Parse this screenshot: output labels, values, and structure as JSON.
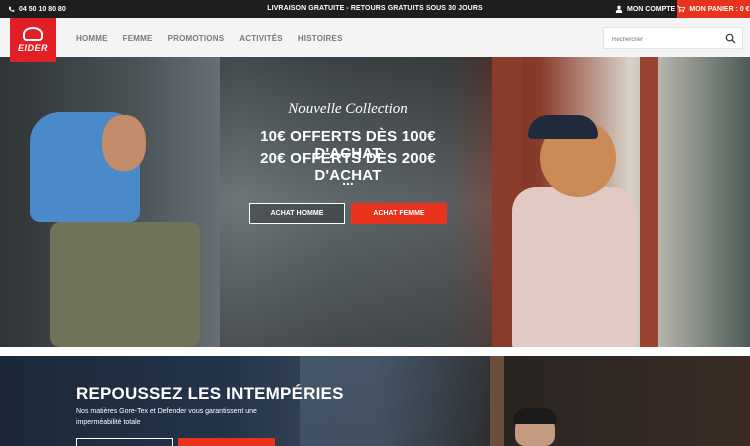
{
  "topbar": {
    "phone": "04 50 10 80 80",
    "promo": "LIVRAISON GRATUITE  -  RETOURS GRATUITS SOUS 30 JOURS",
    "account": "MON COMPTE",
    "cart": "MON PANIER : 0 €"
  },
  "brand": {
    "logo_text": "EIDER"
  },
  "nav": {
    "items": [
      "HOMME",
      "FEMME",
      "PROMOTIONS",
      "ACTIVITÉS",
      "HISTOIRES"
    ]
  },
  "search": {
    "placeholder": "Rechercher"
  },
  "hero": {
    "kicker": "Nouvelle Collection",
    "line1": "10€ OFFERTS DÈS 100€ D'ACHAT",
    "line2": "20€ OFFERTS DÈS 200€ D'ACHAT",
    "dots": "...",
    "btn_men": "ACHAT HOMME",
    "btn_women": "ACHAT FEMME"
  },
  "banner2": {
    "title": "REPOUSSEZ LES INTEMPÉRIES",
    "text": "Nos matières Gore-Tex et Defender vous garantissent une imperméabilité totale"
  },
  "colors": {
    "accent": "#e9331c",
    "dark": "#1e1e1e",
    "logo": "#e41e26"
  }
}
